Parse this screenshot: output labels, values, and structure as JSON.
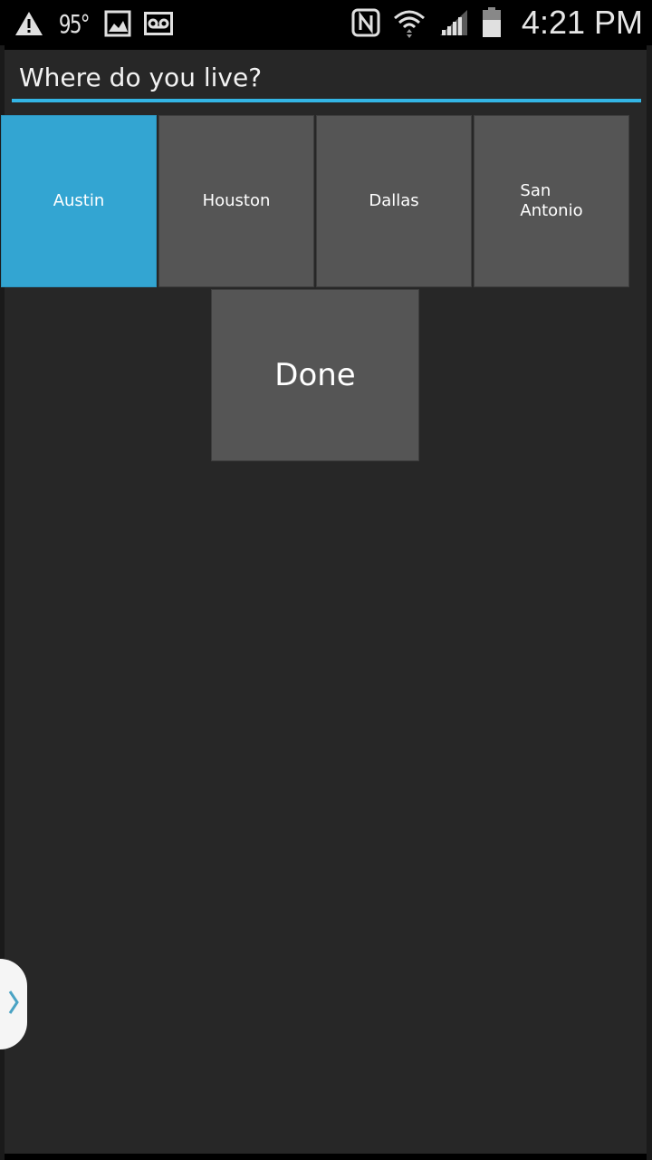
{
  "status_bar": {
    "temperature": "95°",
    "time": "4:21 PM",
    "icons": [
      "warning-icon",
      "gallery-icon",
      "voicemail-icon",
      "nfc-icon",
      "wifi-icon",
      "signal-icon",
      "battery-icon"
    ]
  },
  "dialog": {
    "title": "Where do you live?",
    "accent_color": "#33b5e5",
    "options": [
      {
        "label": "Austin",
        "selected": true
      },
      {
        "label": "Houston",
        "selected": false
      },
      {
        "label": "Dallas",
        "selected": false
      },
      {
        "label": "San\nAntonio",
        "selected": false
      }
    ],
    "done_label": "Done"
  }
}
